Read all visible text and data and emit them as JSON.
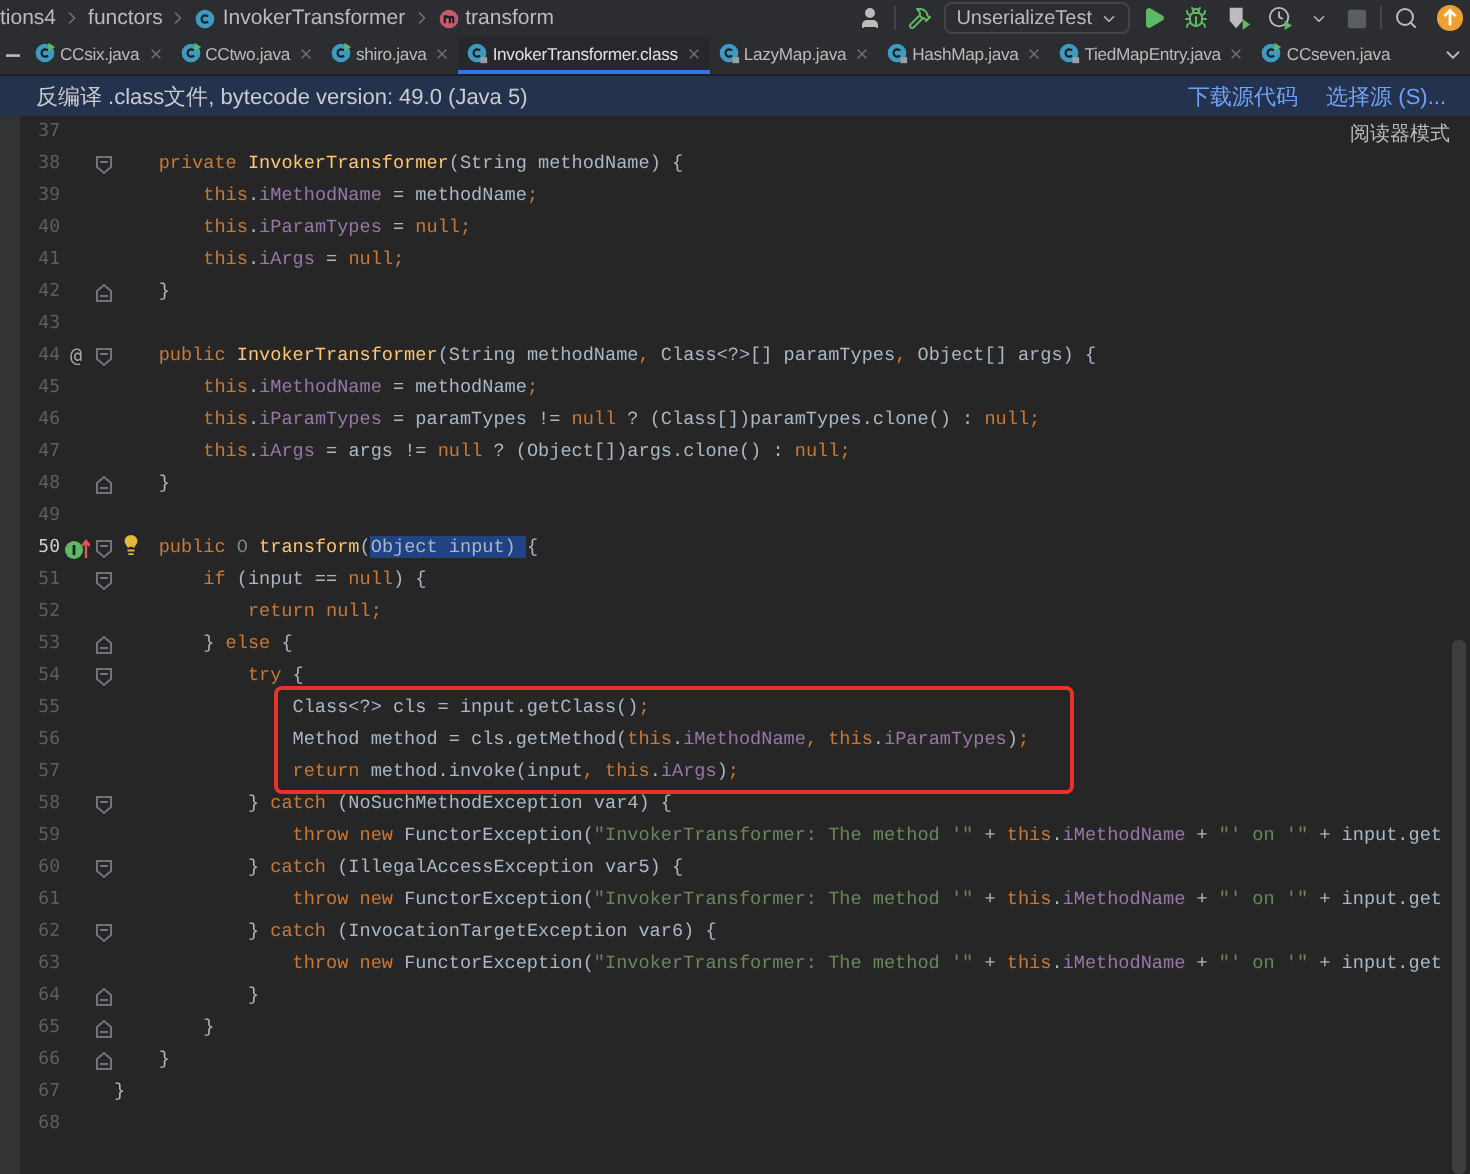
{
  "breadcrumbs": [
    {
      "label": "tions4",
      "kind": "plain"
    },
    {
      "label": "functors",
      "kind": "plain"
    },
    {
      "label": "InvokerTransformer",
      "kind": "class"
    },
    {
      "label": "transform",
      "kind": "method"
    }
  ],
  "run_config": {
    "label": "UnserializeTest"
  },
  "tabs": [
    {
      "label": "CCsix.java",
      "selected": false,
      "kind": "runnable",
      "closable": true
    },
    {
      "label": "CCtwo.java",
      "selected": false,
      "kind": "runnable",
      "closable": true
    },
    {
      "label": "shiro.java",
      "selected": false,
      "kind": "runnable",
      "closable": true
    },
    {
      "label": "InvokerTransformer.class",
      "selected": true,
      "kind": "library",
      "closable": true
    },
    {
      "label": "LazyMap.java",
      "selected": false,
      "kind": "library",
      "closable": true
    },
    {
      "label": "HashMap.java",
      "selected": false,
      "kind": "library",
      "closable": true
    },
    {
      "label": "TiedMapEntry.java",
      "selected": false,
      "kind": "library",
      "closable": true
    },
    {
      "label": "CCseven.java",
      "selected": false,
      "kind": "runnable",
      "closable": false
    }
  ],
  "banner": {
    "message": "反编译 .class文件, bytecode version: 49.0 (Java 5)",
    "links": [
      "下载源代码",
      "选择源 (S)..."
    ]
  },
  "reader_mode": "阅读器模式",
  "lines": [
    {
      "number": "37",
      "kind": "plain",
      "current": false
    },
    {
      "number": "38",
      "kind": "fold-start",
      "current": false,
      "tokens": [
        {
          "kind": "keyword",
          "text": "    private "
        },
        {
          "kind": "decl",
          "text": "InvokerTransformer"
        },
        {
          "kind": "plain",
          "text": "(String methodName) {"
        }
      ]
    },
    {
      "number": "39",
      "kind": "plain",
      "current": false,
      "tokens": [
        {
          "kind": "keyword",
          "text": "        this"
        },
        {
          "kind": "plain",
          "text": "."
        },
        {
          "kind": "field",
          "text": "iMethodName"
        },
        {
          "kind": "plain",
          "text": " = methodName"
        },
        {
          "kind": "keyword",
          "text": ";"
        }
      ]
    },
    {
      "number": "40",
      "kind": "plain",
      "current": false,
      "tokens": [
        {
          "kind": "keyword",
          "text": "        this"
        },
        {
          "kind": "plain",
          "text": "."
        },
        {
          "kind": "field",
          "text": "iParamTypes"
        },
        {
          "kind": "plain",
          "text": " = "
        },
        {
          "kind": "keyword",
          "text": "null;"
        }
      ]
    },
    {
      "number": "41",
      "kind": "plain",
      "current": false,
      "tokens": [
        {
          "kind": "keyword",
          "text": "        this"
        },
        {
          "kind": "plain",
          "text": "."
        },
        {
          "kind": "field",
          "text": "iArgs"
        },
        {
          "kind": "plain",
          "text": " = "
        },
        {
          "kind": "keyword",
          "text": "null;"
        }
      ]
    },
    {
      "number": "42",
      "kind": "fold-end",
      "current": false,
      "tokens": [
        {
          "kind": "plain",
          "text": "    }"
        }
      ]
    },
    {
      "number": "43",
      "kind": "plain",
      "current": false
    },
    {
      "number": "44",
      "kind": "fold-start",
      "current": false,
      "marker": "@",
      "tokens": [
        {
          "kind": "keyword",
          "text": "    public "
        },
        {
          "kind": "decl",
          "text": "InvokerTransformer"
        },
        {
          "kind": "plain",
          "text": "(String methodName"
        },
        {
          "kind": "keyword",
          "text": ","
        },
        {
          "kind": "plain",
          "text": " Class<?>[] paramTypes"
        },
        {
          "kind": "keyword",
          "text": ","
        },
        {
          "kind": "plain",
          "text": " Object[] args) {"
        }
      ]
    },
    {
      "number": "45",
      "kind": "plain",
      "current": false,
      "tokens": [
        {
          "kind": "keyword",
          "text": "        this"
        },
        {
          "kind": "plain",
          "text": "."
        },
        {
          "kind": "field",
          "text": "iMethodName"
        },
        {
          "kind": "plain",
          "text": " = methodName"
        },
        {
          "kind": "keyword",
          "text": ";"
        }
      ]
    },
    {
      "number": "46",
      "kind": "plain",
      "current": false,
      "tokens": [
        {
          "kind": "keyword",
          "text": "        this"
        },
        {
          "kind": "plain",
          "text": "."
        },
        {
          "kind": "field",
          "text": "iParamTypes"
        },
        {
          "kind": "plain",
          "text": " = paramTypes != "
        },
        {
          "kind": "keyword",
          "text": "null"
        },
        {
          "kind": "plain",
          "text": " ? (Class[])paramTypes.clone() : "
        },
        {
          "kind": "keyword",
          "text": "null;"
        }
      ]
    },
    {
      "number": "47",
      "kind": "plain",
      "current": false,
      "tokens": [
        {
          "kind": "keyword",
          "text": "        this"
        },
        {
          "kind": "plain",
          "text": "."
        },
        {
          "kind": "field",
          "text": "iArgs"
        },
        {
          "kind": "plain",
          "text": " = args != "
        },
        {
          "kind": "keyword",
          "text": "null"
        },
        {
          "kind": "plain",
          "text": " ? (Object[])args.clone() : "
        },
        {
          "kind": "keyword",
          "text": "null;"
        }
      ]
    },
    {
      "number": "48",
      "kind": "fold-end",
      "current": false,
      "tokens": [
        {
          "kind": "plain",
          "text": "    }"
        }
      ]
    },
    {
      "number": "49",
      "kind": "plain",
      "current": false
    },
    {
      "number": "50",
      "kind": "fold-start",
      "current": true,
      "gutter": {
        "kind": "implements",
        "bulb": true
      },
      "tokens": [
        {
          "kind": "keyword",
          "text": "    public "
        },
        {
          "kind": "typeparam",
          "text": "O "
        },
        {
          "kind": "decl",
          "text": "transform"
        },
        {
          "kind": "plain",
          "text": "("
        },
        {
          "kind": "selection",
          "text": "Object input) "
        },
        {
          "kind": "plain",
          "text": "{"
        }
      ]
    },
    {
      "number": "51",
      "kind": "fold-start",
      "current": false,
      "tokens": [
        {
          "kind": "keyword",
          "text": "        if"
        },
        {
          "kind": "plain",
          "text": " (input == "
        },
        {
          "kind": "keyword",
          "text": "null"
        },
        {
          "kind": "plain",
          "text": ") {"
        }
      ]
    },
    {
      "number": "52",
      "kind": "plain",
      "current": false,
      "tokens": [
        {
          "kind": "keyword",
          "text": "            return null;"
        }
      ]
    },
    {
      "number": "53",
      "kind": "fold-end",
      "current": false,
      "tokens": [
        {
          "kind": "plain",
          "text": "        } "
        },
        {
          "kind": "keyword",
          "text": "else"
        },
        {
          "kind": "plain",
          "text": " {"
        }
      ]
    },
    {
      "number": "54",
      "kind": "fold-start",
      "current": false,
      "tokens": [
        {
          "kind": "keyword",
          "text": "            try"
        },
        {
          "kind": "plain",
          "text": " {"
        }
      ]
    },
    {
      "kind": "highlight",
      "lines": [
        {
          "number": "55",
          "current": false,
          "tokens": [
            {
              "kind": "plain",
              "text": "                Class<?> cls = input.getClass()"
            },
            {
              "kind": "keyword",
              "text": ";"
            }
          ]
        },
        {
          "number": "56",
          "current": false,
          "tokens": [
            {
              "kind": "plain",
              "text": "                Method method = cls.getMethod("
            },
            {
              "kind": "keyword",
              "text": "this"
            },
            {
              "kind": "plain",
              "text": "."
            },
            {
              "kind": "field",
              "text": "iMethodName"
            },
            {
              "kind": "keyword",
              "text": ", this"
            },
            {
              "kind": "plain",
              "text": "."
            },
            {
              "kind": "field",
              "text": "iParamTypes"
            },
            {
              "kind": "plain",
              "text": ")"
            },
            {
              "kind": "keyword",
              "text": ";"
            }
          ]
        },
        {
          "number": "57",
          "current": false,
          "tokens": [
            {
              "kind": "keyword",
              "text": "                return"
            },
            {
              "kind": "plain",
              "text": " method.invoke(input"
            },
            {
              "kind": "keyword",
              "text": ", this"
            },
            {
              "kind": "plain",
              "text": "."
            },
            {
              "kind": "field",
              "text": "iArgs"
            },
            {
              "kind": "plain",
              "text": ")"
            },
            {
              "kind": "keyword",
              "text": ";"
            }
          ]
        }
      ]
    },
    {
      "number": "58",
      "kind": "fold-start",
      "current": false,
      "tokens": [
        {
          "kind": "plain",
          "text": "            } "
        },
        {
          "kind": "keyword",
          "text": "catch"
        },
        {
          "kind": "plain",
          "text": " (NoSuchMethodException var4) {"
        }
      ]
    },
    {
      "number": "59",
      "kind": "plain",
      "current": false,
      "tokens": [
        {
          "kind": "keyword",
          "text": "                throw new"
        },
        {
          "kind": "plain",
          "text": " FunctorException("
        },
        {
          "kind": "string",
          "text": "\"InvokerTransformer: The method '\""
        },
        {
          "kind": "plain",
          "text": " + "
        },
        {
          "kind": "keyword",
          "text": "this"
        },
        {
          "kind": "plain",
          "text": "."
        },
        {
          "kind": "field",
          "text": "iMethodName"
        },
        {
          "kind": "plain",
          "text": " + "
        },
        {
          "kind": "string",
          "text": "\"' on '\""
        },
        {
          "kind": "plain",
          "text": " + input.get"
        }
      ]
    },
    {
      "number": "60",
      "kind": "fold-start",
      "current": false,
      "tokens": [
        {
          "kind": "plain",
          "text": "            } "
        },
        {
          "kind": "keyword",
          "text": "catch"
        },
        {
          "kind": "plain",
          "text": " (IllegalAccessException var5) {"
        }
      ]
    },
    {
      "number": "61",
      "kind": "plain",
      "current": false,
      "tokens": [
        {
          "kind": "keyword",
          "text": "                throw new"
        },
        {
          "kind": "plain",
          "text": " FunctorException("
        },
        {
          "kind": "string",
          "text": "\"InvokerTransformer: The method '\""
        },
        {
          "kind": "plain",
          "text": " + "
        },
        {
          "kind": "keyword",
          "text": "this"
        },
        {
          "kind": "plain",
          "text": "."
        },
        {
          "kind": "field",
          "text": "iMethodName"
        },
        {
          "kind": "plain",
          "text": " + "
        },
        {
          "kind": "string",
          "text": "\"' on '\""
        },
        {
          "kind": "plain",
          "text": " + input.get"
        }
      ]
    },
    {
      "number": "62",
      "kind": "fold-start",
      "current": false,
      "tokens": [
        {
          "kind": "plain",
          "text": "            } "
        },
        {
          "kind": "keyword",
          "text": "catch"
        },
        {
          "kind": "plain",
          "text": " (InvocationTargetException var6) {"
        }
      ]
    },
    {
      "number": "63",
      "kind": "plain",
      "current": false,
      "tokens": [
        {
          "kind": "keyword",
          "text": "                throw new"
        },
        {
          "kind": "plain",
          "text": " FunctorException("
        },
        {
          "kind": "string",
          "text": "\"InvokerTransformer: The method '\""
        },
        {
          "kind": "plain",
          "text": " + "
        },
        {
          "kind": "keyword",
          "text": "this"
        },
        {
          "kind": "plain",
          "text": "."
        },
        {
          "kind": "field",
          "text": "iMethodName"
        },
        {
          "kind": "plain",
          "text": " + "
        },
        {
          "kind": "string",
          "text": "\"' on '\""
        },
        {
          "kind": "plain",
          "text": " + input.get"
        }
      ]
    },
    {
      "number": "64",
      "kind": "fold-end",
      "current": false,
      "tokens": [
        {
          "kind": "plain",
          "text": "            }"
        }
      ]
    },
    {
      "number": "65",
      "kind": "fold-end",
      "current": false,
      "tokens": [
        {
          "kind": "plain",
          "text": "        }"
        }
      ]
    },
    {
      "number": "66",
      "kind": "fold-end",
      "current": false,
      "tokens": [
        {
          "kind": "plain",
          "text": "    }"
        }
      ]
    },
    {
      "number": "67",
      "kind": "plain",
      "current": false,
      "tokens": [
        {
          "kind": "plain",
          "text": "}"
        }
      ]
    },
    {
      "number": "68",
      "kind": "plain",
      "current": false
    }
  ]
}
